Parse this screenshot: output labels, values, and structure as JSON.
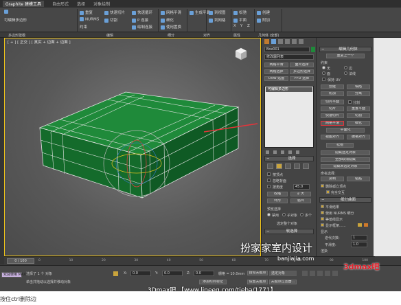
{
  "app": {
    "window_tabs": [
      "Graphite 建模工具",
      "自由形式",
      "选择",
      "对象绘制"
    ],
    "active_tab": "Graphite 建模工具"
  },
  "ribbon": {
    "row1": [
      "重复",
      "快速切片",
      "快速循环",
      "网格平滑",
      "NURMS",
      "切割",
      "绘制连接",
      "细分化",
      "细化",
      "使用置换",
      "约束",
      "边",
      "面",
      "生成平面",
      "到视图",
      "到网格",
      "松弛",
      "平面",
      "XYZ",
      "X",
      "Y",
      "Z",
      "创建",
      "附加"
    ],
    "top_items": [
      "重复",
      "快速切片",
      "快速循环",
      "网格平滑",
      "生成平面",
      "到视图",
      "松弛",
      "创建"
    ],
    "mid_items": [
      "NURMS",
      "切割",
      "P 连接",
      "细化",
      "到网格",
      "平面",
      "附加"
    ],
    "bottom_items": [
      "约束",
      "绘制连接",
      "使用置换",
      "X",
      "Y",
      "Z"
    ],
    "groups": [
      "多边形建模",
      "编辑",
      "细分",
      "对齐",
      "属性",
      "几何体 (全部)"
    ]
  },
  "subbar": {
    "label": "可编辑多边形"
  },
  "viewport": {
    "label": "[ + ] [ 正交 ] [ 真实 + 边面 + 边面 ]",
    "cube_color": "#1f8a3a",
    "edge_color": "#e6e6e6",
    "arrow_color": "#e8333a"
  },
  "command_panel": {
    "object_name": "Box001",
    "modifier_list": "修改器列表",
    "buttons": [
      "网格平滑",
      "面片选择",
      "网格选择",
      "多边形选择",
      "UVW 贴图",
      "FFD 选择"
    ],
    "stack_item": "可编辑多边形",
    "selection_rollout": "选择",
    "select_options": [
      "按顶点",
      "忽略背面",
      "按角度",
      "收缩",
      "扩大",
      "环形",
      "循环"
    ],
    "select_by_angle": "45.0",
    "preview_selection": "预览选择",
    "preview_options": [
      "禁用",
      "子对象",
      "多个"
    ],
    "selected_count": "选定整个对象",
    "soft_selection": "软选择"
  },
  "command_panel_right": {
    "edit_geometry": "编辑几何体",
    "repeat_last": "重复上一个",
    "constraints": "约束",
    "constraint_options": [
      "无",
      "边",
      "面",
      "法线"
    ],
    "preserve_uv": "保持 UV",
    "create": "创建",
    "collapse": "塌陷",
    "attach": "附加",
    "detach": "分离",
    "slice_plane": "切片平面",
    "split": "分割",
    "slice": "切片",
    "reset_plane": "重置平面",
    "quickslice": "快速切片",
    "cut": "切割",
    "meshsmooth": "网格平滑",
    "tessellate": "细化",
    "make_planar": "平面化",
    "view_align": "视图对齐",
    "grid_align": "栅格对齐",
    "relax": "松弛",
    "hide_selected": "隐藏选定对象",
    "unhide_all": "全部取消隐藏",
    "hide_unselected": "隐藏未选定对象",
    "named_selections": "命名选择:",
    "copy": "复制",
    "paste": "粘贴",
    "delete_isolated": "删除孤立顶点",
    "full_interactivity": "完全交互",
    "subdivision_surface": "细分曲面",
    "smooth_result": "平滑结果",
    "use_nurms": "使用 NURMS 细分",
    "isoline_display": "等值线显示",
    "show_cage": "显示框架......",
    "display": "显示",
    "iterations_label": "迭代次数:",
    "iterations_value": "1",
    "smoothness_label": "平滑度:",
    "smoothness_value": "1.0",
    "render": "渲染",
    "render_iterations": "0",
    "render_smoothness": "1.0"
  },
  "timeline": {
    "frame": "0 / 100",
    "ticks": [
      "0",
      "10",
      "20",
      "30",
      "40",
      "50",
      "60",
      "70",
      "80",
      "90",
      "100"
    ]
  },
  "status": {
    "selected": "选择了 1 个 对象",
    "hint": "单击并拖动以选择并移动对象",
    "script_label": "欢迎使用 MAXS",
    "x_label": "X:",
    "x_value": "0.0",
    "y_label": "Y:",
    "y_value": "0.0",
    "z_label": "Z:",
    "z_value": "0.0",
    "grid": "栅格 = 10.0mm",
    "auto_key": "自动关键点",
    "set_key": "设置关键点",
    "selected_objects": "选定对象",
    "add_time_tag": "添加时间标记",
    "key_filters": "关键点过滤器..."
  },
  "watermarks": {
    "brand": "扮家家室内设计",
    "brand_url": "banjiajia.com",
    "forum": "3Dmax吧 【www.lineeg.com/tieba/1771】",
    "corner": "3dmax吧"
  },
  "caption": "按住ctrl删除边"
}
